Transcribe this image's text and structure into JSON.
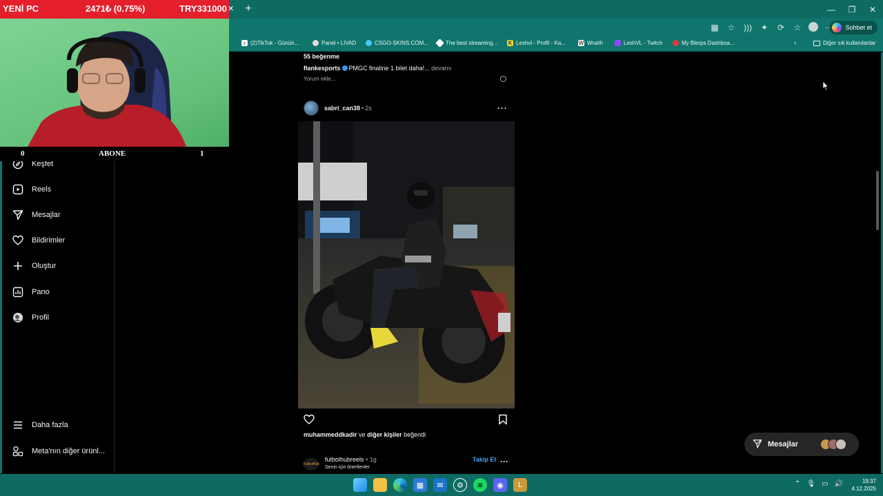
{
  "overlay": {
    "title": "YENİ PC",
    "price": "2471₺ (0.75%)",
    "ticker": "TRY331000",
    "sub_left": "0",
    "sub_label": "ABONE",
    "sub_right": "1"
  },
  "browser": {
    "copilot_label": "Sohbet et",
    "bookmarks": [
      {
        "label": "(2)TikTok - Günün...",
        "color": "#ffffff",
        "glyph": "♪"
      },
      {
        "label": "Panel • LIVAD",
        "color": "#dddddd",
        "glyph": "●"
      },
      {
        "label": "CSGO-SKINS.COM...",
        "color": "#4ac6f0",
        "glyph": "◆"
      },
      {
        "label": "The best streaming...",
        "color": "#ffffff",
        "glyph": "◆"
      },
      {
        "label": "Leshvl - Profil - Ka...",
        "color": "#f2d33b",
        "glyph": "K"
      },
      {
        "label": "Wraith",
        "color": "#ffffff",
        "glyph": "W"
      },
      {
        "label": "LeshVL - Twitch",
        "color": "#9146ff",
        "glyph": "▮"
      },
      {
        "label": "My Blerps Dashboa...",
        "color": "#e23b3b",
        "glyph": "●"
      }
    ],
    "other_bookmarks": "Diğer sık kullanılanlar"
  },
  "sidebar": {
    "items": [
      {
        "label": "Keşfet",
        "icon": "compass-icon"
      },
      {
        "label": "Reels",
        "icon": "reels-icon"
      },
      {
        "label": "Mesajlar",
        "icon": "send-icon"
      },
      {
        "label": "Bildirimler",
        "icon": "heart-icon"
      },
      {
        "label": "Oluştur",
        "icon": "plus-icon"
      },
      {
        "label": "Pano",
        "icon": "dashboard-icon"
      },
      {
        "label": "Profil",
        "icon": "avatar-icon"
      }
    ],
    "more": "Daha fazla",
    "meta": "Meta'nın diğer ürünl..."
  },
  "feed": {
    "prev_likes": "55 beğenme",
    "prev_user": "flankesports",
    "prev_caption": "PMGC finaline 1 bilet daha!...",
    "prev_more": "devamı",
    "comment_placeholder": "Yorum ekle...",
    "post": {
      "user": "sabri_can38",
      "sep": "•",
      "time": "2s",
      "liked_user": "muhammeddkadir",
      "liked_and": "ve",
      "liked_others": "diğer kişiler",
      "liked_suffix": "beğendi"
    },
    "next": {
      "user": "futbolhubreels",
      "sep": "•",
      "time": "1g",
      "subtitle": "Senin için önerilenler",
      "follow": "Takip Et",
      "avatar_text": "FutbolHub"
    }
  },
  "messages_pill": {
    "label": "Mesajlar"
  },
  "taskbar": {
    "time": "19:37",
    "date": "4.12.2025"
  }
}
